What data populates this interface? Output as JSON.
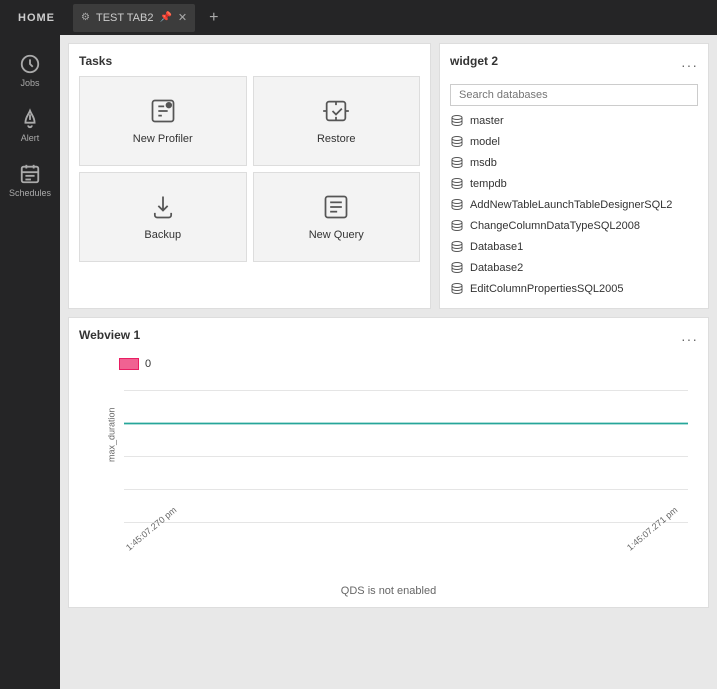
{
  "topbar": {
    "home_label": "HOME",
    "tab_name": "TEST TAB2",
    "add_tab_label": "+"
  },
  "sidebar": {
    "items": [
      {
        "id": "jobs",
        "label": "Jobs"
      },
      {
        "id": "alert",
        "label": "Alert"
      },
      {
        "id": "schedules",
        "label": "Schedules"
      }
    ]
  },
  "tasks_widget": {
    "title": "Tasks",
    "items": [
      {
        "id": "new-profiler",
        "label": "New Profiler"
      },
      {
        "id": "restore",
        "label": "Restore"
      },
      {
        "id": "backup",
        "label": "Backup"
      },
      {
        "id": "new-query",
        "label": "New Query"
      }
    ]
  },
  "widget2": {
    "title": "widget 2",
    "search_placeholder": "Search databases",
    "databases": [
      "master",
      "model",
      "msdb",
      "tempdb",
      "AddNewTableLaunchTableDesignerSQL2",
      "ChangeColumnDataTypeSQL2008",
      "Database1",
      "Database2",
      "EditColumnPropertiesSQL2005"
    ]
  },
  "webview": {
    "title": "Webview 1",
    "legend_label": "0",
    "y_axis_label": "max_duration",
    "x_label_left": "1:45:07.270 pm",
    "x_label_right": "1:45:07.271 pm",
    "footer_text": "QDS is not enabled",
    "chart_line_value": "0.5",
    "y_ticks": [
      "1.0",
      "0.5",
      "0.0",
      "-0.5",
      "-1.0"
    ]
  }
}
